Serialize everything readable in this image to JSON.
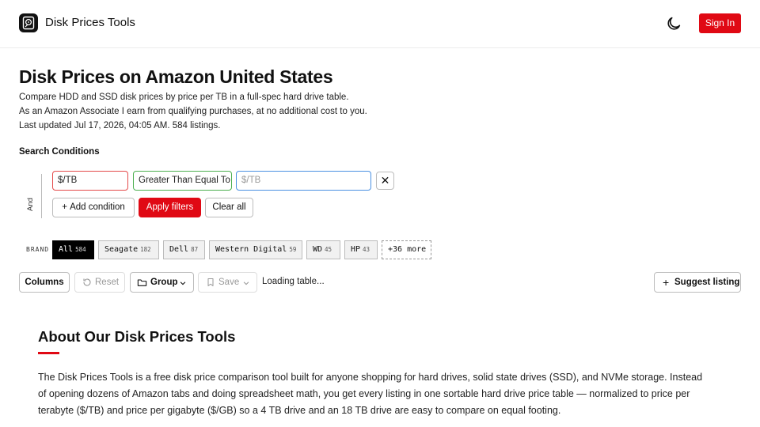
{
  "header": {
    "brand_name": "Disk Prices Tools",
    "theme_icon": "moon-icon",
    "signin_label": "Sign In"
  },
  "main": {
    "title": "Disk Prices on Amazon United States",
    "desc_lines": [
      "Compare HDD and SSD disk prices by price per TB in a full-spec hard drive table.",
      "As an Amazon Associate I earn from qualifying purchases, at no additional cost to you.",
      "Last updated Jul 17, 2026, 04:05 AM. 584 listings."
    ]
  },
  "search": {
    "heading": "Search Conditions",
    "and_label": "And",
    "condition": {
      "column": "$/TB",
      "operator": "Greater Than Equal To",
      "value": "",
      "value_placeholder": "$/TB"
    },
    "add_condition_label": "Add condition",
    "apply_label": "Apply filters",
    "clear_label": "Clear all"
  },
  "brand_filter": {
    "label": "BRAND",
    "chips": [
      {
        "name": "All",
        "count": "584",
        "active": true
      },
      {
        "name": "Seagate",
        "count": "182"
      },
      {
        "name": "Dell",
        "count": "87"
      },
      {
        "name": "Western Digital",
        "count": "59"
      },
      {
        "name": "WD",
        "count": "45"
      },
      {
        "name": "HP",
        "count": "43"
      }
    ],
    "more_label": "+36 more"
  },
  "toolbar": {
    "columns_label": "Columns",
    "reset_label": "Reset",
    "group_label": "Group",
    "save_label": "Save",
    "loading_text": "Loading table...",
    "suggest_label": "Suggest listing"
  },
  "about": {
    "title": "About Our Disk Prices Tools",
    "lines": [
      "The Disk Prices Tools is a free disk price comparison tool built for anyone shopping for hard drives, solid state drives (SSD), and NVMe storage. Instead",
      "of opening dozens of Amazon tabs and doing spreadsheet math, you get every listing in one sortable hard drive price table — normalized to price per",
      "terabyte ($/TB) and price per gigabyte ($/GB) so a 4 TB drive and an 18 TB drive are easy to compare on equal footing."
    ]
  },
  "colors": {
    "accent": "#e00914",
    "text": "#111111",
    "column_border": "#e44a4a",
    "operator_border": "#4caf50",
    "value_border": "#4a90e2"
  }
}
